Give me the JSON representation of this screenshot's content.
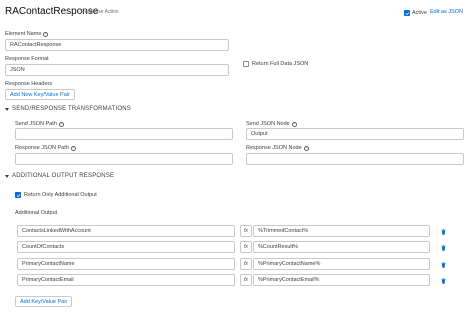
{
  "header": {
    "title": "RAContactResponse",
    "subtitle": "Response Action",
    "active_label": "Active",
    "edit_json_label": "Edit as JSON"
  },
  "element_name": {
    "label": "Element Name",
    "value": "RAContactResponse"
  },
  "response_format": {
    "label": "Response Format",
    "value": "JSON"
  },
  "return_full_data": {
    "label": "Return Full Data JSON"
  },
  "response_headers": {
    "label": "Response Headers",
    "add_button": "Add New Key/Value Pair"
  },
  "transformations": {
    "section_title": "SEND/RESPONSE TRANSFORMATIONS",
    "send_json_path": {
      "label": "Send JSON Path",
      "value": ""
    },
    "send_json_node": {
      "label": "Send JSON Node",
      "value": "Output"
    },
    "response_json_path": {
      "label": "Response JSON Path",
      "value": ""
    },
    "response_json_node": {
      "label": "Response JSON Node",
      "value": ""
    }
  },
  "additional_output": {
    "section_title": "ADDITIONAL OUTPUT RESPONSE",
    "return_only_label": "Return Only Additional Output",
    "label": "Additional Output",
    "fx_label": "fx",
    "rows": [
      {
        "key": "ContactsLinkedWithAccount",
        "value": "%TrimmedContact%"
      },
      {
        "key": "CountOfContacts",
        "value": "%CountResult%"
      },
      {
        "key": "PrimaryContactName",
        "value": "%PrimaryContactName%"
      },
      {
        "key": "PrimaryContactEmail",
        "value": "%PrimaryContactEmail%"
      }
    ],
    "add_button": "Add Key/Value Pair"
  },
  "colors": {
    "accent": "#0070d2",
    "text": "#3e3e3c",
    "border": "#c9c9c9"
  }
}
